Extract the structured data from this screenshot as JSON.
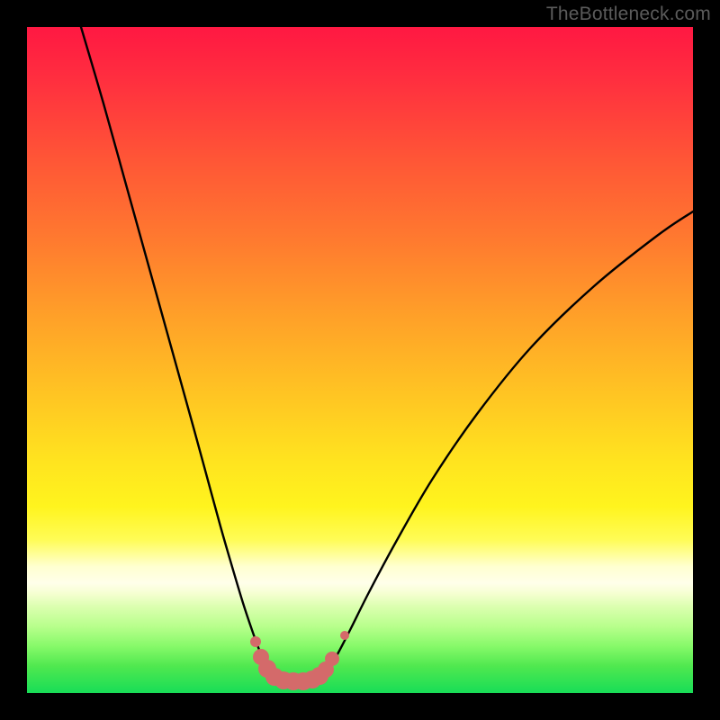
{
  "watermark": "TheBottleneck.com",
  "colors": {
    "background": "#000000",
    "curve_stroke": "#000000",
    "marker_fill": "#d46a6a",
    "marker_stroke": "#d46a6a",
    "gradient_stops": [
      "#ff1842",
      "#ff2f3f",
      "#ff5636",
      "#ff7a2f",
      "#ffa228",
      "#ffc423",
      "#ffe31f",
      "#fff41e",
      "#fffc56",
      "#ffffd0",
      "#ffffea",
      "#f6ffd2",
      "#dcffb0",
      "#b8ff8c",
      "#86f969",
      "#4fe84f",
      "#18dd57"
    ]
  },
  "chart_data": {
    "type": "line",
    "title": "",
    "xlabel": "",
    "ylabel": "",
    "xlim": [
      0,
      740
    ],
    "ylim_note": "pixel-space, y increases downward; higher y = better (green)",
    "series": [
      {
        "name": "left-branch",
        "x": [
          60,
          85,
          110,
          135,
          160,
          185,
          200,
          215,
          228,
          240,
          250,
          258,
          266,
          272
        ],
        "y": [
          0,
          85,
          175,
          265,
          355,
          445,
          500,
          555,
          600,
          640,
          670,
          692,
          710,
          723
        ]
      },
      {
        "name": "floor",
        "x": [
          272,
          280,
          290,
          300,
          310,
          320,
          328
        ],
        "y": [
          723,
          726,
          727,
          727,
          727,
          726,
          723
        ]
      },
      {
        "name": "right-branch",
        "x": [
          328,
          336,
          346,
          360,
          380,
          410,
          450,
          500,
          560,
          630,
          700,
          740
        ],
        "y": [
          723,
          712,
          695,
          668,
          628,
          572,
          503,
          430,
          356,
          288,
          232,
          205
        ]
      }
    ],
    "markers": {
      "name": "highlighted-points",
      "comment": "Pink rounded markers near the valley floor",
      "points": [
        {
          "x": 254,
          "y": 683,
          "r": 6
        },
        {
          "x": 260,
          "y": 700,
          "r": 9
        },
        {
          "x": 267,
          "y": 713,
          "r": 10
        },
        {
          "x": 275,
          "y": 722,
          "r": 10
        },
        {
          "x": 285,
          "y": 726,
          "r": 10
        },
        {
          "x": 296,
          "y": 727,
          "r": 10
        },
        {
          "x": 307,
          "y": 727,
          "r": 10
        },
        {
          "x": 317,
          "y": 725,
          "r": 10
        },
        {
          "x": 325,
          "y": 721,
          "r": 10
        },
        {
          "x": 332,
          "y": 714,
          "r": 9
        },
        {
          "x": 339,
          "y": 702,
          "r": 8
        },
        {
          "x": 353,
          "y": 676,
          "r": 5
        }
      ]
    }
  }
}
